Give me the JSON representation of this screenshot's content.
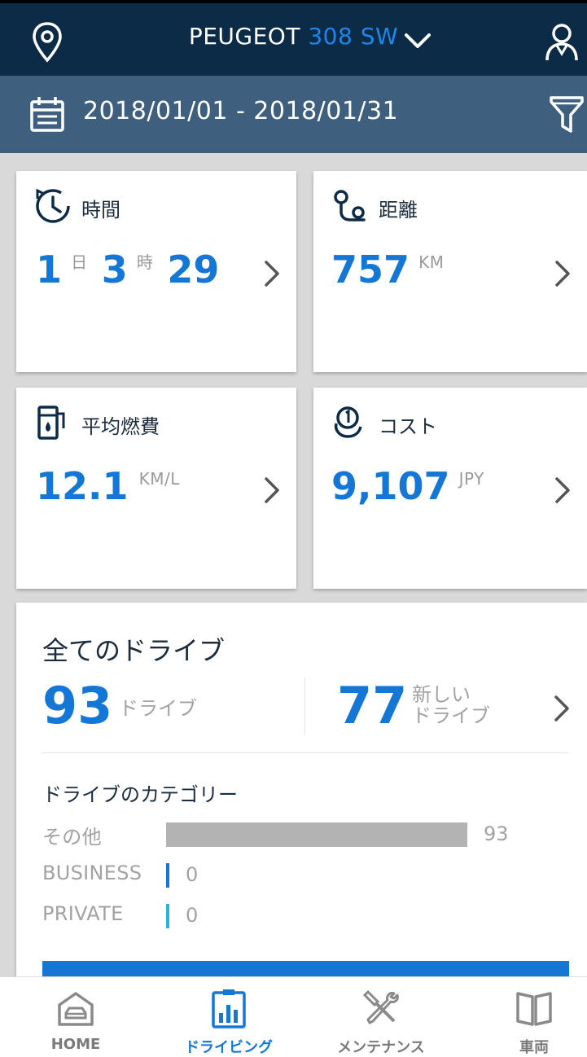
{
  "header": {
    "brand": "PEUGEOT",
    "model": "308 SW",
    "icons": {
      "location": "location-pin-icon",
      "dropdown": "chevron-down-icon",
      "profile": "user-icon"
    }
  },
  "date_filter": {
    "range": "2018/01/01 - 2018/01/31",
    "icons": {
      "calendar": "calendar-icon",
      "filter": "filter-icon"
    }
  },
  "cards": {
    "time": {
      "label": "時間",
      "days": "1",
      "days_unit": "日",
      "hours": "3",
      "hours_unit": "時",
      "minutes": "29",
      "icon": "clock-icon"
    },
    "distance": {
      "label": "距離",
      "value": "757",
      "unit": "KM",
      "icon": "route-icon"
    },
    "fuel": {
      "label": "平均燃費",
      "value": "12.1",
      "unit": "KM/L",
      "icon": "fuel-pump-icon"
    },
    "cost": {
      "label": "コスト",
      "value": "9,107",
      "unit": "JPY",
      "icon": "coins-icon"
    }
  },
  "all_drives": {
    "heading": "全てのドライブ",
    "total": "93",
    "total_label": "ドライブ",
    "new": "77",
    "new_label_line1": "新しい",
    "new_label_line2": "ドライブ",
    "category_heading": "ドライブのカテゴリー",
    "categories": [
      {
        "label": "その他",
        "value": "93",
        "count": 93,
        "color": "#b3b3b3"
      },
      {
        "label": "BUSINESS",
        "value": "0",
        "count": 0,
        "color": "#1477d6"
      },
      {
        "label": "PRIVATE",
        "value": "0",
        "count": 0,
        "color": "#27b4d8"
      }
    ]
  },
  "tabbar": {
    "tabs": [
      {
        "label": "HOME",
        "icon": "garage-car-icon",
        "active": false
      },
      {
        "label": "ドライビング",
        "icon": "bar-chart-icon",
        "active": true
      },
      {
        "label": "メンテナンス",
        "icon": "tools-icon",
        "active": false
      },
      {
        "label": "車両",
        "icon": "book-icon",
        "active": false
      }
    ]
  },
  "colors": {
    "navy": "#0c2b47",
    "steel": "#3f5f7e",
    "accent": "#1477d6"
  }
}
